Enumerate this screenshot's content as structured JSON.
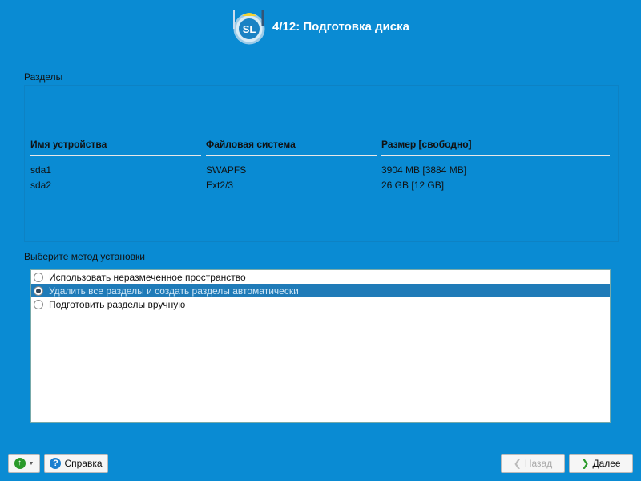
{
  "header": {
    "title": "4/12: Подготовка диска",
    "logo_text": "SL"
  },
  "partitions": {
    "label": "Разделы",
    "columns": [
      "Имя устройства",
      "Файловая система",
      "Размер [свободно]"
    ],
    "rows": [
      [
        "sda1",
        "SWAPFS",
        "3904 MB [3884 MB]"
      ],
      [
        "sda2",
        "Ext2/3",
        "26 GB [12 GB]"
      ]
    ]
  },
  "method": {
    "label": "Выберите метод установки",
    "options": [
      {
        "label": "Использовать неразмеченное пространство",
        "selected": false
      },
      {
        "label": "Удалить все разделы и создать разделы автоматически",
        "selected": true
      },
      {
        "label": "Подготовить разделы вручную",
        "selected": false
      }
    ]
  },
  "footer": {
    "help": "Справка",
    "back": "Назад",
    "next": "Далее"
  }
}
